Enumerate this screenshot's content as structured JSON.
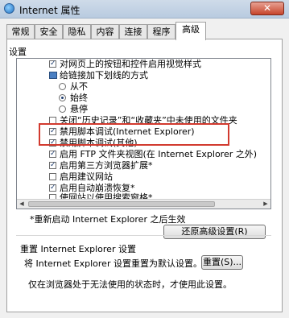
{
  "window": {
    "title": "Internet 属性",
    "close_symbol": "✕"
  },
  "tabs": [
    {
      "label": "常规",
      "active": false
    },
    {
      "label": "安全",
      "active": false
    },
    {
      "label": "隐私",
      "active": false
    },
    {
      "label": "内容",
      "active": false
    },
    {
      "label": "连接",
      "active": false
    },
    {
      "label": "程序",
      "active": false
    },
    {
      "label": "高级",
      "active": true
    }
  ],
  "settings": {
    "group_label": "设置",
    "items": [
      {
        "type": "checkbox",
        "checked": true,
        "label": "对网页上的按钮和控件启用视觉样式"
      },
      {
        "type": "folder",
        "label": "给链接加下划线的方式"
      },
      {
        "type": "radio",
        "checked": false,
        "label": "从不"
      },
      {
        "type": "radio",
        "checked": true,
        "label": "始终"
      },
      {
        "type": "radio",
        "checked": false,
        "label": "悬停"
      },
      {
        "type": "checkbox",
        "checked": false,
        "label": "关闭“历史记录”和“收藏夹”中未使用的文件夹"
      },
      {
        "type": "checkbox",
        "checked": true,
        "label": "禁用脚本调试(Internet Explorer)"
      },
      {
        "type": "checkbox",
        "checked": true,
        "label": "禁用脚本调试(其他)"
      },
      {
        "type": "checkbox",
        "checked": true,
        "label": "启用 FTP 文件夹视图(在 Internet Explorer 之外)"
      },
      {
        "type": "checkbox",
        "checked": true,
        "label": "启用第三方浏览器扩展*"
      },
      {
        "type": "checkbox",
        "checked": false,
        "label": "启用建议网站"
      },
      {
        "type": "checkbox",
        "checked": true,
        "label": "启用自动崩溃恢复*"
      },
      {
        "type": "checkbox",
        "checked": false,
        "label": "使网站以使用搜索窗格*"
      }
    ],
    "scroll_left": "◀",
    "scroll_right": "▶"
  },
  "restart_note": "*重新启动 Internet Explorer 之后生效",
  "restore_button": "还原高级设置(R)",
  "reset_section": {
    "title": "重置 Internet Explorer 设置",
    "description": "将 Internet Explorer 设置重置为默认设置。",
    "button": "重置(S)...",
    "note": "仅在浏览器处于无法使用的状态时，才使用此设置。"
  }
}
